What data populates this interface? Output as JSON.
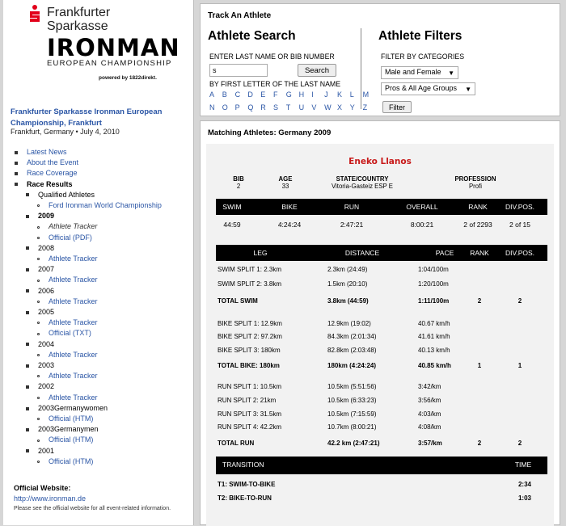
{
  "logo": {
    "bank_line1": "Frankfurter",
    "bank_line2": "Sparkasse",
    "brand": "IRONMAN",
    "subtitle": "EUROPEAN CHAMPIONSHIP",
    "powered": "powered by 1822direkt."
  },
  "event": {
    "title": "Frankfurter Sparkasse Ironman European Championship, Frankfurt",
    "meta": "Frankfurt, Germany • July 4, 2010"
  },
  "nav": {
    "latest": "Latest News",
    "about": "About the Event",
    "coverage": "Race Coverage",
    "results": "Race Results",
    "qualified": "Qualified Athletes",
    "kona": "Ford Ironman World Championship",
    "y2009": "2009",
    "y2009_tracker": "Athlete Tracker",
    "y2009_official": "Official (PDF)",
    "y2008": "2008",
    "y2008_tracker": "Athlete Tracker",
    "y2007": "2007",
    "y2007_tracker": "Athlete Tracker",
    "y2006": "2006",
    "y2006_tracker": "Athlete Tracker",
    "y2005": "2005",
    "y2005_tracker": "Athlete Tracker",
    "y2005_official": "Official (TXT)",
    "y2004": "2004",
    "y2004_tracker": "Athlete Tracker",
    "y2003": "2003",
    "y2003_tracker": "Athlete Tracker",
    "y2002": "2002",
    "y2002_tracker": "Athlete Tracker",
    "y2003w": "2003Germanywomen",
    "y2003w_official": "Official (HTM)",
    "y2003m": "2003Germanymen",
    "y2003m_official": "Official (HTM)",
    "y2001": "2001",
    "y2001_official": "Official (HTM)"
  },
  "official": {
    "heading": "Official Website:",
    "link": "http://www.ironman.de",
    "note": "Please see the official website for all event-related information."
  },
  "search": {
    "track_title": "Track An Athlete",
    "title": "Athlete Search",
    "last_label": "ENTER LAST NAME OR BIB NUMBER",
    "input_value": "s",
    "button": "Search",
    "first_label": "BY FIRST LETTER OF THE LAST NAME",
    "letters_row1": [
      "A",
      "B",
      "C",
      "D",
      "E",
      "F",
      "G",
      "H",
      "I",
      "J",
      "K",
      "L",
      "M"
    ],
    "letters_row2": [
      "N",
      "O",
      "P",
      "Q",
      "R",
      "S",
      "T",
      "U",
      "V",
      "W",
      "X",
      "Y",
      "Z"
    ]
  },
  "filters": {
    "title": "Athlete Filters",
    "label": "FILTER BY CATEGORIES",
    "gender": "Male and Female",
    "group": "Pros & All Age Groups",
    "button": "Filter"
  },
  "results": {
    "title": "Matching Athletes: Germany 2009",
    "athlete": "Eneko Llanos",
    "info_headers": {
      "bib": "BIB",
      "age": "AGE",
      "state": "STATE/COUNTRY",
      "profession": "PROFESSION"
    },
    "info_values": {
      "bib": "2",
      "age": "33",
      "state": "Vitoria-Gasteiz ESP E",
      "profession": "Profi"
    },
    "summary_headers": [
      "SWIM",
      "BIKE",
      "RUN",
      "OVERALL",
      "RANK",
      "DIV.POS."
    ],
    "summary_values": [
      "44:59",
      "4:24:24",
      "2:47:21",
      "8:00:21",
      "2 of 2293",
      "2 of 15"
    ],
    "leg_headers": [
      "LEG",
      "DISTANCE",
      "PACE",
      "RANK",
      "DIV.POS."
    ],
    "legs": [
      {
        "leg": "SWIM SPLIT 1: 2.3km",
        "distance": "2.3km (24:49)",
        "pace": "1:04/100m",
        "rank": "",
        "div": "",
        "total": false
      },
      {
        "leg": "SWIM SPLIT 2: 3.8km",
        "distance": "1.5km (20:10)",
        "pace": "1:20/100m",
        "rank": "",
        "div": "",
        "total": false
      },
      {
        "leg": "TOTAL SWIM",
        "distance": "3.8km (44:59)",
        "pace": "1:11/100m",
        "rank": "2",
        "div": "2",
        "total": true
      },
      {
        "leg": "BIKE SPLIT 1: 12.9km",
        "distance": "12.9km (19:02)",
        "pace": "40.67 km/h",
        "rank": "",
        "div": "",
        "total": false
      },
      {
        "leg": "BIKE SPLIT 2: 97.2km",
        "distance": "84.3km (2:01:34)",
        "pace": "41.61 km/h",
        "rank": "",
        "div": "",
        "total": false
      },
      {
        "leg": "BIKE SPLIT 3: 180km",
        "distance": "82.8km (2:03:48)",
        "pace": "40.13 km/h",
        "rank": "",
        "div": "",
        "total": false
      },
      {
        "leg": "TOTAL BIKE: 180km",
        "distance": "180km (4:24:24)",
        "pace": "40.85 km/h",
        "rank": "1",
        "div": "1",
        "total": true
      },
      {
        "leg": "RUN SPLIT 1: 10.5km",
        "distance": "10.5km (5:51:56)",
        "pace": "3:42/km",
        "rank": "",
        "div": "",
        "total": false
      },
      {
        "leg": "RUN SPLIT 2: 21km",
        "distance": "10.5km (6:33:23)",
        "pace": "3:56/km",
        "rank": "",
        "div": "",
        "total": false
      },
      {
        "leg": "RUN SPLIT 3: 31.5km",
        "distance": "10.5km (7:15:59)",
        "pace": "4:03/km",
        "rank": "",
        "div": "",
        "total": false
      },
      {
        "leg": "RUN SPLIT 4: 42.2km",
        "distance": "10.7km (8:00:21)",
        "pace": "4:08/km",
        "rank": "",
        "div": "",
        "total": false
      },
      {
        "leg": "TOTAL RUN",
        "distance": "42.2 km (2:47:21)",
        "pace": "3:57/km",
        "rank": "2",
        "div": "2",
        "total": true
      }
    ],
    "transition_headers": [
      "TRANSITION",
      "TIME"
    ],
    "transitions": [
      {
        "name": "T1: SWIM-TO-BIKE",
        "time": "2:34"
      },
      {
        "name": "T2: BIKE-TO-RUN",
        "time": "1:03"
      }
    ]
  }
}
